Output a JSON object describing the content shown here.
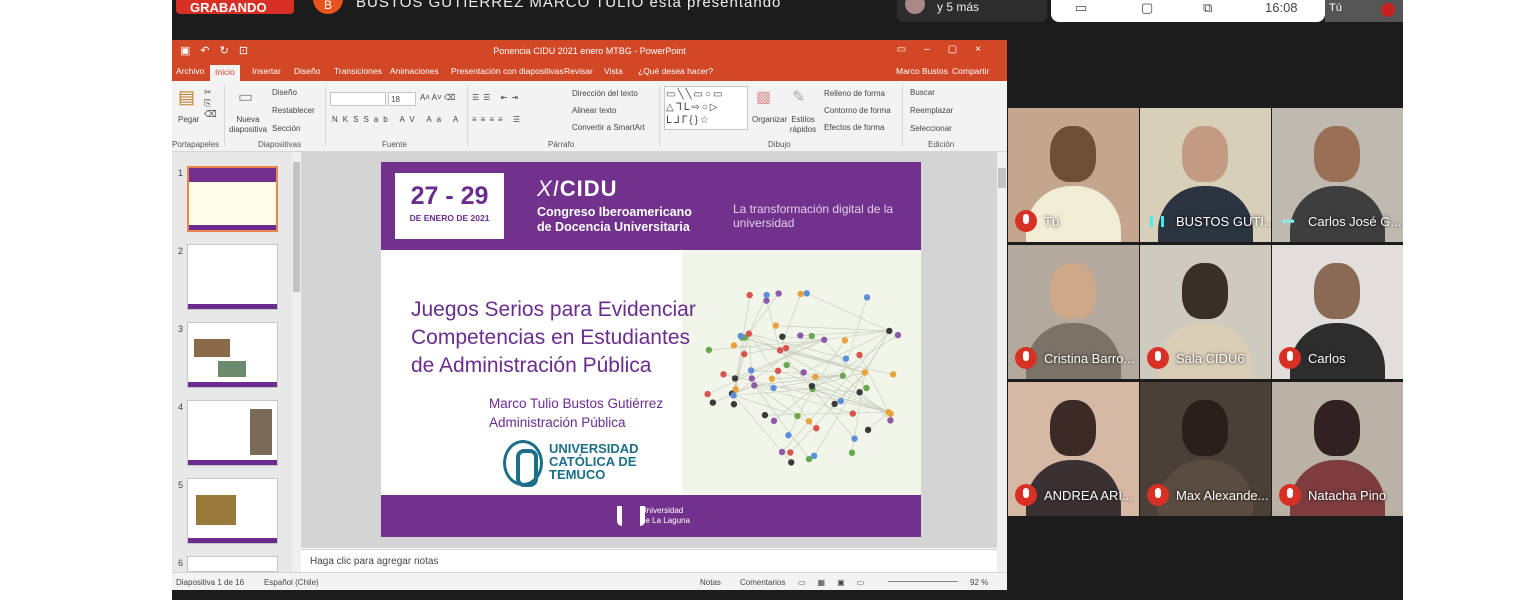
{
  "meeting": {
    "record_label": "GRABANDO",
    "presenter_initial": "B",
    "presenting_text": "BUSTOS GUTIERREZ MARCO TULIO está presentando",
    "people_more": "y 5 más",
    "time": "16:08",
    "self_mini_label": "Tú"
  },
  "ppt": {
    "window_title": "Ponencia CIDU 2021 enero MTBG - PowerPoint",
    "tabs": [
      "Archivo",
      "Inicio",
      "Insertar",
      "Diseño",
      "Transiciones",
      "Animaciones",
      "Presentación con diapositivas",
      "Revisar",
      "Vista",
      "¿Qué desea hacer?"
    ],
    "user": "Marco Bustos",
    "share": "Compartir",
    "ribbon": {
      "paste": "Pegar",
      "new_slide": "Nueva diapositiva",
      "layout": "Diseño",
      "reset": "Restablecer",
      "section": "Sección",
      "font_size": "18",
      "text_direction": "Dirección del texto",
      "align_text": "Alinear texto",
      "smartart": "Convertir a SmartArt",
      "arrange": "Organizar",
      "quick_styles": "Estilos rápidos",
      "shape_fill": "Relleno de forma",
      "shape_outline": "Contorno de forma",
      "shape_effects": "Efectos de forma",
      "find": "Buscar",
      "replace": "Reemplazar",
      "select": "Seleccionar",
      "groups": [
        "Portapapeles",
        "Diapositivas",
        "Fuente",
        "Párrafo",
        "Dibujo",
        "Edición"
      ]
    },
    "thumb_numbers": [
      "1",
      "2",
      "3",
      "4",
      "5",
      "6"
    ],
    "notes_placeholder": "Haga clic para agregar notas",
    "status": {
      "slide_count": "Diapositiva 1 de 16",
      "language": "Español (Chile)",
      "notes": "Notas",
      "comments": "Comentarios",
      "zoom": "92 %"
    }
  },
  "slide": {
    "dates": "27 - 29",
    "date_sub": "DE ENERO DE 2021",
    "logo_prefix": "XI",
    "logo_main": "CIDU",
    "congress_line1": "Congreso Iberoamericano",
    "congress_line2": "de Docencia Universitaria",
    "tagline": "La transformación digital de la universidad",
    "title_line1": "Juegos Serios para Evidenciar",
    "title_line2": "Competencias en Estudiantes",
    "title_line3": "de Administración Pública",
    "author": "Marco Tulio Bustos Gutiérrez",
    "department": "Administración Pública",
    "university_line1": "UNIVERSIDAD",
    "university_line2": "CATÓLICA DE",
    "university_line3": "TEMUCO",
    "footer_line1": "Universidad",
    "footer_line2": "de La Laguna"
  },
  "participants": [
    {
      "name": "Tú"
    },
    {
      "name": "BUSTOS GUTI..."
    },
    {
      "name": "Carlos José G..."
    },
    {
      "name": "Cristina Barro..."
    },
    {
      "name": "Sala CIDU6"
    },
    {
      "name": "Carlos"
    },
    {
      "name": "ANDREA ARI..."
    },
    {
      "name": "Max Alexande..."
    },
    {
      "name": "Natacha Pino"
    }
  ],
  "colors": {
    "ppt_accent": "#d24726",
    "slide_purple": "#71318c",
    "mute_red": "#d93025"
  }
}
